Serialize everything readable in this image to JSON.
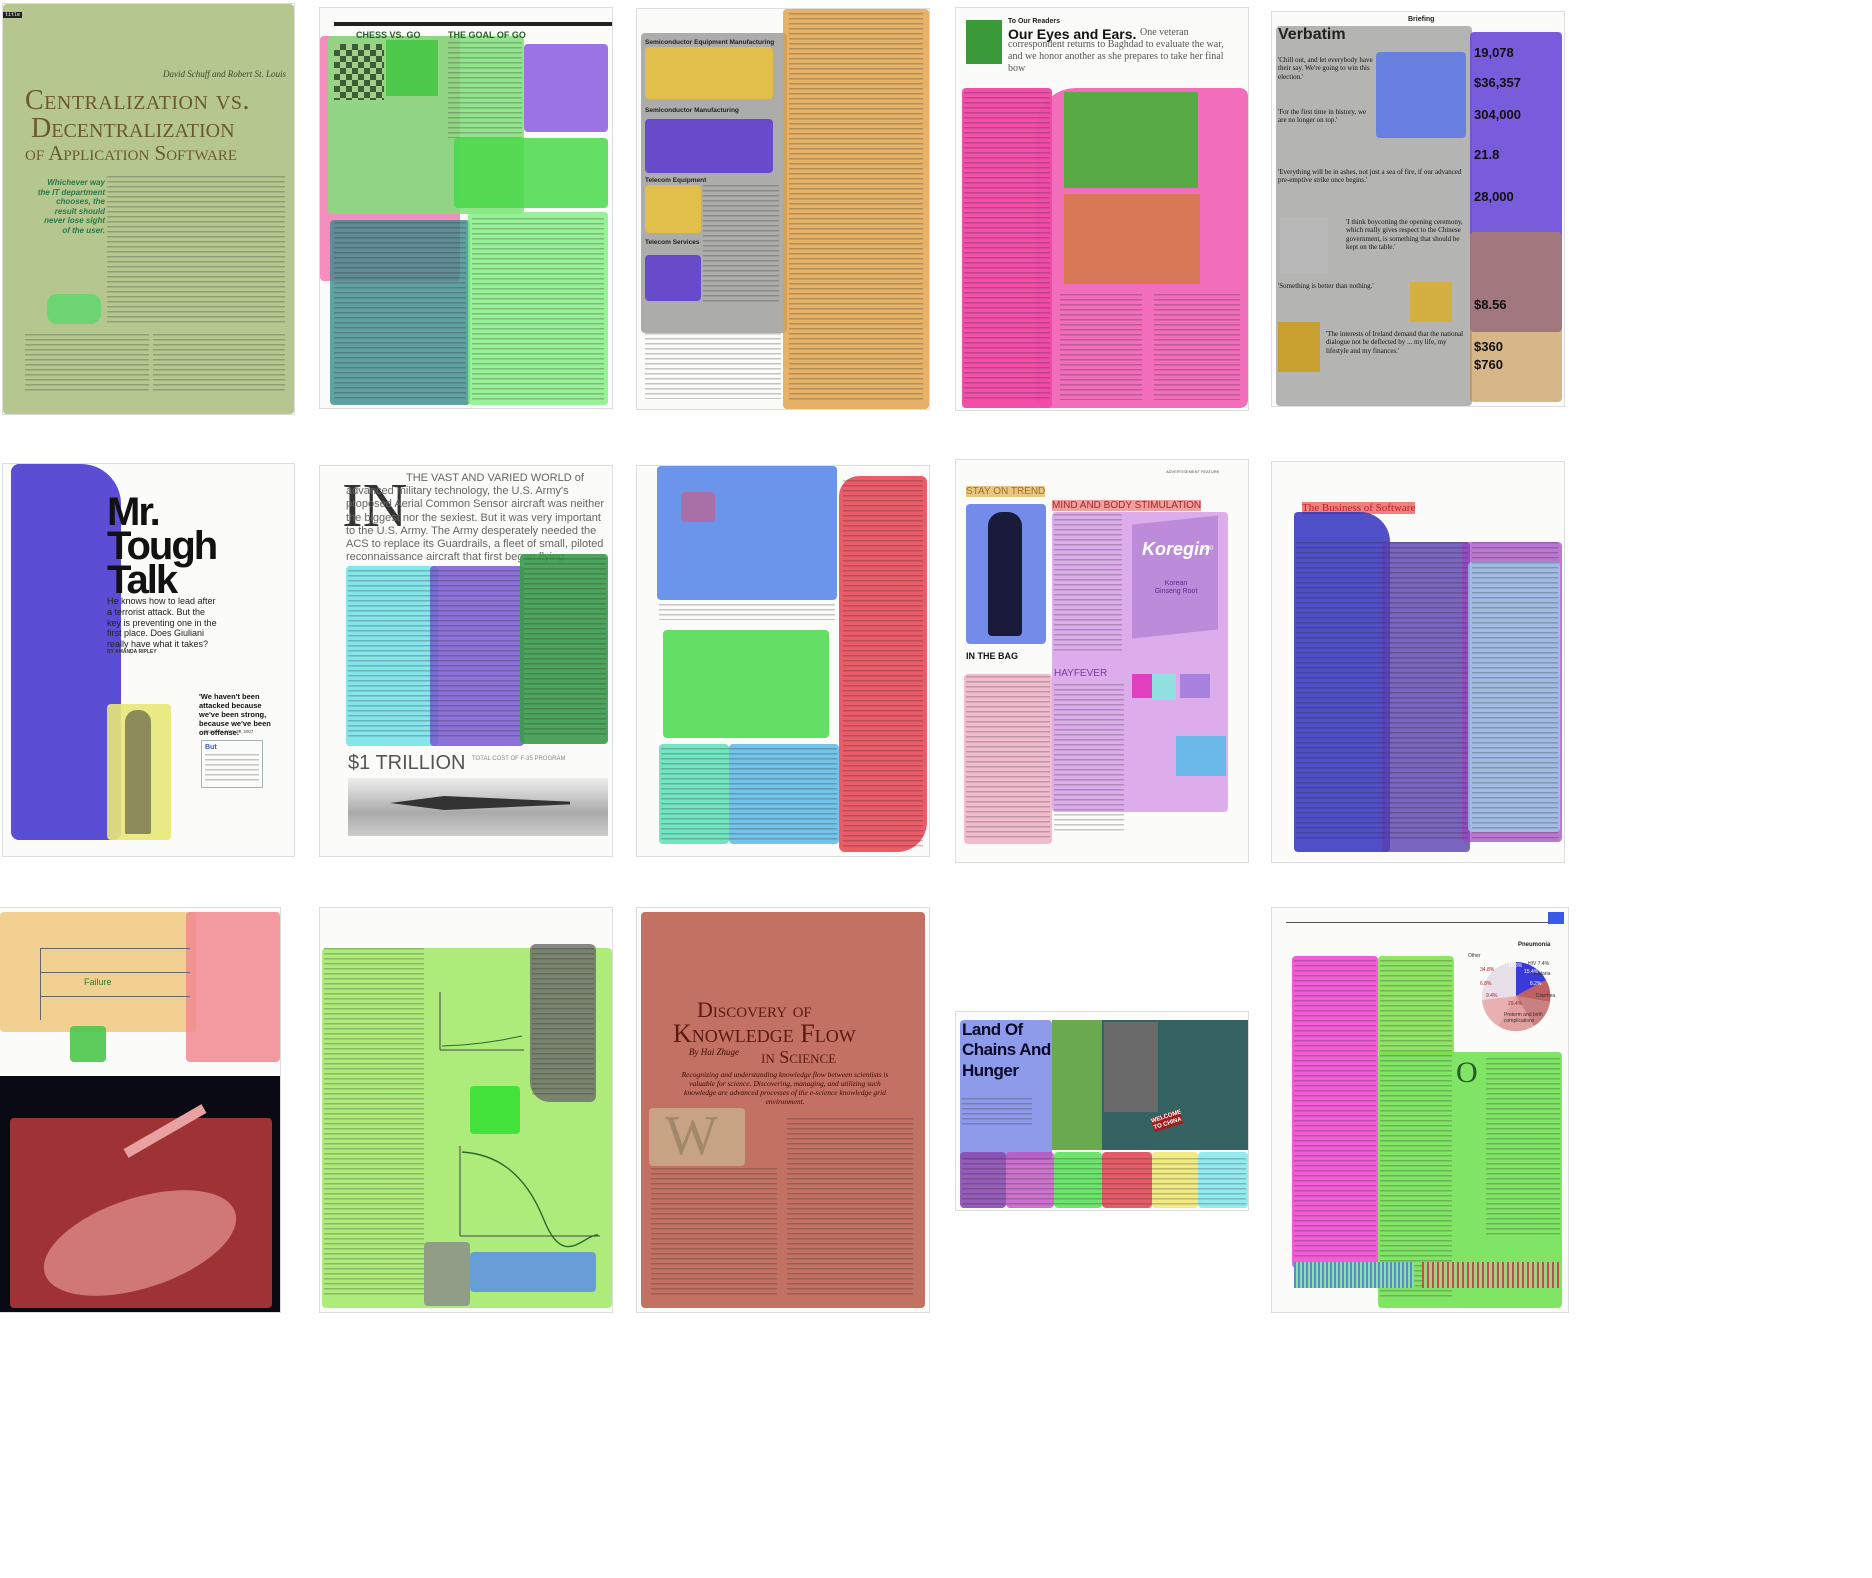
{
  "colors": {
    "olive": "#a8bd7c",
    "green": "#57d457",
    "lime": "#8fe05a",
    "purple": "#7a56d8",
    "blue": "#4a5fd8",
    "pink": "#f03ca8",
    "red": "#e05060",
    "orange": "#e8a040",
    "gold": "#e8c040",
    "teal": "#3a8c8c",
    "cyan": "#90e8ee",
    "salmon": "#e8908c",
    "brown": "#b05040",
    "mag": "#c040c8"
  },
  "p1": {
    "authors": "David Schuff and Robert St. Louis",
    "title1": "Centralization vs.",
    "title2": "Decentralization",
    "title3": "of Application Software",
    "pull": "Whichever way the IT department chooses, the result should never lose sight of the user."
  },
  "p2": {
    "h1": "CHESS VS. GO",
    "h2": "THE GOAL OF GO"
  },
  "p3": {
    "h1": "Semiconductor Equipment Manufacturing",
    "h2": "Semiconductor Manufacturing",
    "h3": "Telecom Equipment",
    "h4": "Telecom Services"
  },
  "p4": {
    "kicker": "To Our Readers",
    "head": "Our Eyes and Ears.",
    "deck": "One veteran correspondent returns to Baghdad to evaluate the war, and we honor another as she prepares to take her final bow"
  },
  "p5": {
    "section": "Briefing",
    "title": "Verbatim",
    "q1": "'Chill out, and let everybody have their say. We're going to win this election.'",
    "q2": "'For the first time in history, we are no longer on top.'",
    "q3": "'Everything will be in ashes, not just a sea of fire, if our advanced pre-emptive strike once begins.'",
    "q4": "'I think boycotting the opening ceremony, which really gives respect to the Chinese government, is something that should be kept on the table.'",
    "q5": "'Something is better than nothing.'",
    "q6": "'The interests of Ireland demand that the national dialogue not be deflected by ... my life, my lifestyle and my finances.'",
    "n1": "19,078",
    "n2": "$36,357",
    "n3": "304,000",
    "n4": "21.8",
    "n5": "28,000",
    "n6": "$8.56",
    "n7": "$360",
    "n8": "$760"
  },
  "p6": {
    "t1": "Mr.",
    "t2": "Tough",
    "t3": "Talk",
    "deck": "He knows how to lead after a terrorist attack. But the key is preventing one in the first place. Does Giuliani really have what it takes?",
    "byline": "BY AMANDA RIPLEY",
    "pull": "'We haven't been attacked because we've been strong, because we've been on offense.'",
    "pullsrc": "—GIULIANI, MAY 15, 2007",
    "cap": "But"
  },
  "p7": {
    "dropcap": "IN",
    "lead": "THE VAST AND VARIED WORLD of advanced military technology, the U.S. Army's proposed Aerial Common Sensor aircraft was neither the biggest nor the sexiest. But it was very important to the U.S. Army. The Army desperately needed the ACS to replace its Guardrails, a fleet of small, piloted reconnaissance aircraft that first began flying",
    "big": "$1 TRILLION",
    "bigdeck": "TOTAL COST OF F-35 PROGRAM"
  },
  "p9": {
    "feature": "ADVERTISEMENT FEATURE",
    "h1": "STAY ON TREND",
    "h2": "MIND AND BODY STIMULATION",
    "h3": "IN THE BAG",
    "h4": "HAYFEVER",
    "brand": "Koregin",
    "brandnum": "2000",
    "sub": "Korean Ginseng Root"
  },
  "p10": {
    "title": "The Business of Software"
  },
  "p11": {
    "label": "Failure"
  },
  "p13": {
    "t1": "Discovery of",
    "t2": "Knowledge Flow",
    "t3": "in Science",
    "byline": "By Hai Zhuge",
    "dek": "Recognizing and understanding knowledge flow between scientists is valuable for science. Discovering, managing, and utilizing such knowledge are advanced processes of the e-science knowledge grid environment.",
    "cap": "W"
  },
  "p14": {
    "title": "Land Of Chains And Hunger",
    "sign": "WELCOME TO CHINA"
  },
  "p15": {
    "pie": "Pneumonia",
    "lab1": "Other",
    "lab2": "HIV 7.4%",
    "lab3": "Malaria",
    "lab4": "Diarrhea",
    "lab5": "Preterm and birth complications",
    "drop": "O",
    "p1": "34.8%",
    "p2": "18.3%",
    "p3": "6.8%",
    "p4": "8.2%",
    "p5": "9.4%",
    "p6": "15.4%",
    "p7": "29.4%"
  }
}
